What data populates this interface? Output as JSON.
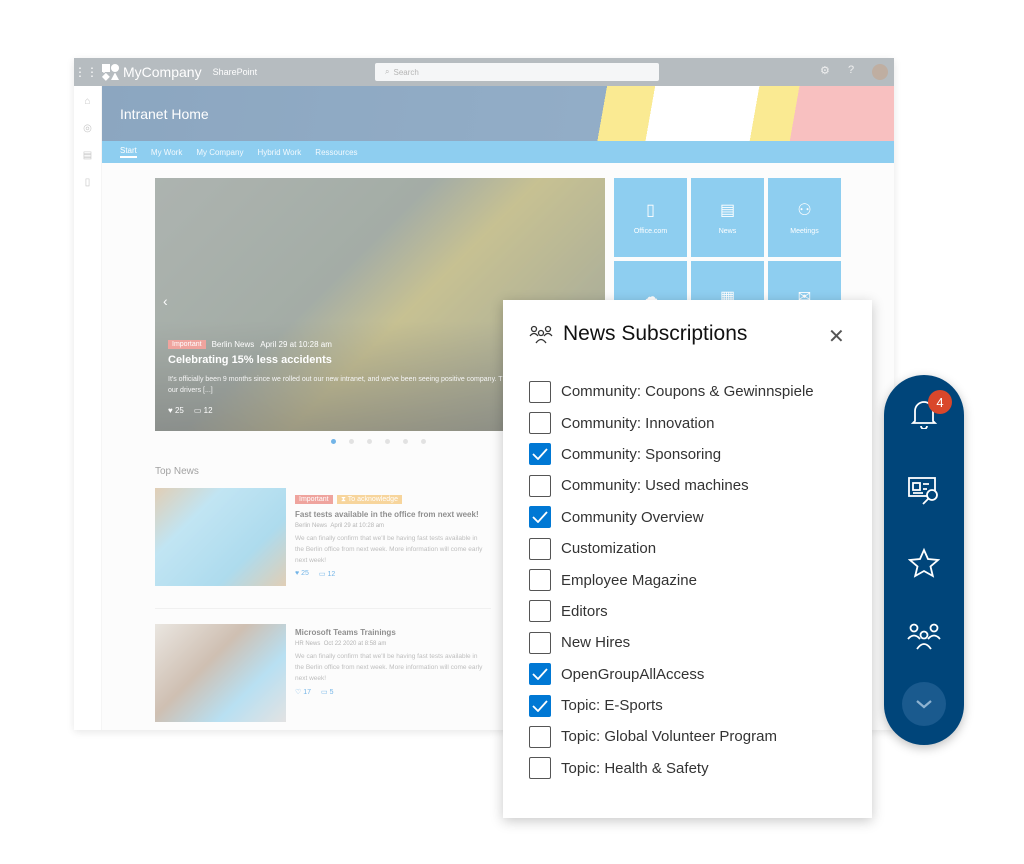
{
  "topbar": {
    "brand": "MyCompany",
    "product": "SharePoint",
    "search_placeholder": "Search"
  },
  "site": {
    "title": "Intranet Home",
    "nav": [
      "Start",
      "My Work",
      "My Company",
      "Hybrid Work",
      "Ressources"
    ]
  },
  "hero": {
    "tag": "Important",
    "source": "Berlin News",
    "date": "April 29 at 10:28 am",
    "title": "Celebrating 15% less accidents",
    "body": "It's officially been 9 months since we rolled out our new intranet, and we've been seeing positive company. This one goes to the innovation of our drivers [...]",
    "likes": "25",
    "comments": "12",
    "slides": 6,
    "active_slide": 1
  },
  "top_news": {
    "heading": "Top News",
    "items": [
      {
        "tags": [
          "Important",
          "To acknowledge"
        ],
        "title": "Fast tests available in the office from next week!",
        "source": "Berlin News",
        "date": "April 29 at 10:28 am",
        "body": "We can finally confirm that we'll be having fast tests available in the Berlin office from next week. More information will come early next week!",
        "likes": "25",
        "comments": "12"
      },
      {
        "tags": [],
        "title": "Microsoft Teams Trainings",
        "source": "HR News",
        "date": "Oct 22 2020 at 8:58 am",
        "body": "We can finally confirm that we'll be having fast tests available in the Berlin office from next week. More information will come early next week!",
        "likes": "17",
        "comments": "5"
      }
    ]
  },
  "tiles": [
    {
      "label": "Office.com",
      "icon": "office-icon"
    },
    {
      "label": "News",
      "icon": "newspaper-icon"
    },
    {
      "label": "Meetings",
      "icon": "people-icon"
    },
    {
      "label": "",
      "icon": "cloud-icon"
    },
    {
      "label": "",
      "icon": "notepad-icon"
    },
    {
      "label": "",
      "icon": "mail-icon"
    }
  ],
  "panel": {
    "title": "News Subscriptions",
    "items": [
      {
        "label": "Community: Coupons & Gewinnspiele",
        "checked": false
      },
      {
        "label": "Community: Innovation",
        "checked": false
      },
      {
        "label": "Community: Sponsoring",
        "checked": true
      },
      {
        "label": "Community: Used machines",
        "checked": false
      },
      {
        "label": "Community Overview",
        "checked": true
      },
      {
        "label": "Customization",
        "checked": false
      },
      {
        "label": "Employee Magazine",
        "checked": false
      },
      {
        "label": "Editors",
        "checked": false
      },
      {
        "label": "New Hires",
        "checked": false
      },
      {
        "label": "OpenGroupAllAccess",
        "checked": true
      },
      {
        "label": "Topic: E-Sports",
        "checked": true
      },
      {
        "label": "Topic: Global Volunteer Program",
        "checked": false
      },
      {
        "label": "Topic: Health & Safety",
        "checked": false
      }
    ]
  },
  "fab": {
    "notification_count": "4"
  },
  "colors": {
    "accent": "#0078d4",
    "fab": "#00457a",
    "badge": "#d9472b",
    "nav": "#33a7e5"
  }
}
